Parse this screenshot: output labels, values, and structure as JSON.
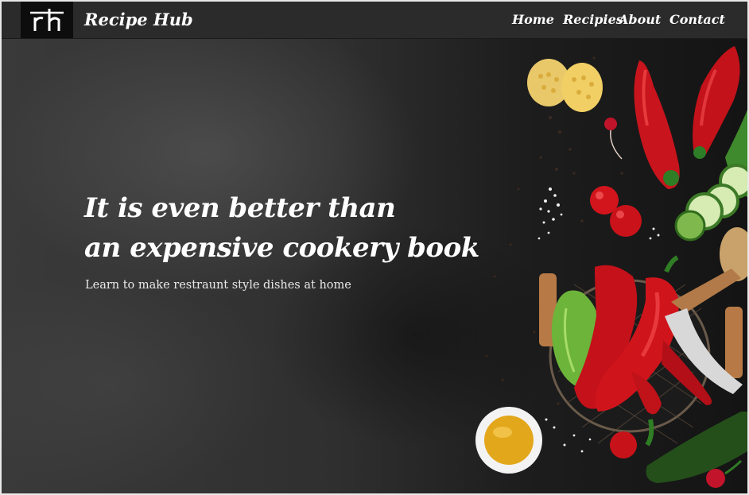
{
  "navbar": {
    "logo_text": "rh",
    "brand": "Recipe Hub",
    "links": [
      "Home",
      "Recipies",
      "About",
      "Contact"
    ]
  },
  "hero": {
    "title_line1": "It is even better than",
    "title_line2": "an expensive cookery book",
    "subtitle": "Learn to make restraunt style dishes at home"
  },
  "colors": {
    "navbar_bg": "#2b2b2b",
    "logo_bg": "#0d0d0d",
    "text": "#ffffff"
  }
}
